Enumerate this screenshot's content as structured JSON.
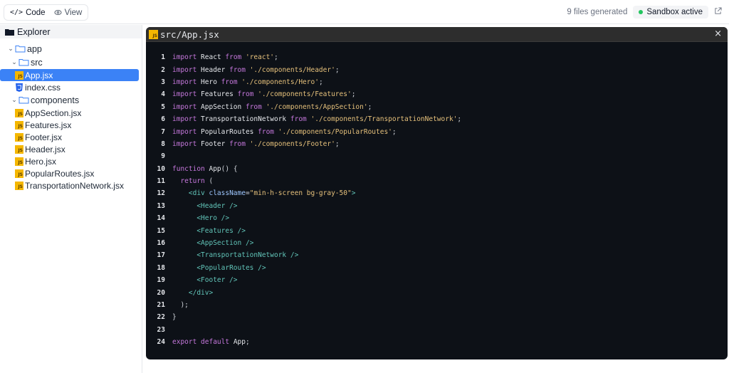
{
  "toolbar": {
    "code_label": "Code",
    "code_icon": "</>",
    "view_label": "View",
    "files_generated": "9 files generated",
    "sandbox_status": "Sandbox active",
    "status_color": "#22c55e"
  },
  "explorer": {
    "title": "Explorer",
    "root": "app",
    "src": "src",
    "app_file": "App.jsx",
    "css_file": "index.css",
    "components_folder": "components",
    "components": [
      "AppSection.jsx",
      "Features.jsx",
      "Footer.jsx",
      "Header.jsx",
      "Hero.jsx",
      "PopularRoutes.jsx",
      "TransportationNetwork.jsx"
    ]
  },
  "editor": {
    "file_path": "src/App.jsx",
    "close_label": "×",
    "lines": [
      [
        [
          "kw",
          "import"
        ],
        [
          "id",
          " React "
        ],
        [
          "kw",
          "from"
        ],
        [
          "str",
          " 'react'"
        ],
        [
          "pun",
          ";"
        ]
      ],
      [
        [
          "kw",
          "import"
        ],
        [
          "id",
          " Header "
        ],
        [
          "kw",
          "from"
        ],
        [
          "str",
          " './components/Header'"
        ],
        [
          "pun",
          ";"
        ]
      ],
      [
        [
          "kw",
          "import"
        ],
        [
          "id",
          " Hero "
        ],
        [
          "kw",
          "from"
        ],
        [
          "str",
          " './components/Hero'"
        ],
        [
          "pun",
          ";"
        ]
      ],
      [
        [
          "kw",
          "import"
        ],
        [
          "id",
          " Features "
        ],
        [
          "kw",
          "from"
        ],
        [
          "str",
          " './components/Features'"
        ],
        [
          "pun",
          ";"
        ]
      ],
      [
        [
          "kw",
          "import"
        ],
        [
          "id",
          " AppSection "
        ],
        [
          "kw",
          "from"
        ],
        [
          "str",
          " './components/AppSection'"
        ],
        [
          "pun",
          ";"
        ]
      ],
      [
        [
          "kw",
          "import"
        ],
        [
          "id",
          " TransportationNetwork "
        ],
        [
          "kw",
          "from"
        ],
        [
          "str",
          " './components/TransportationNetwork'"
        ],
        [
          "pun",
          ";"
        ]
      ],
      [
        [
          "kw",
          "import"
        ],
        [
          "id",
          " PopularRoutes "
        ],
        [
          "kw",
          "from"
        ],
        [
          "str",
          " './components/PopularRoutes'"
        ],
        [
          "pun",
          ";"
        ]
      ],
      [
        [
          "kw",
          "import"
        ],
        [
          "id",
          " Footer "
        ],
        [
          "kw",
          "from"
        ],
        [
          "str",
          " './components/Footer'"
        ],
        [
          "pun",
          ";"
        ]
      ],
      [],
      [
        [
          "kw",
          "function"
        ],
        [
          "fn",
          " App"
        ],
        [
          "pun",
          "() {"
        ]
      ],
      [
        [
          "kw",
          "  return"
        ],
        [
          "pun",
          " ("
        ]
      ],
      [
        [
          "tag",
          "    <div"
        ],
        [
          "attr",
          " className"
        ],
        [
          "pun",
          "="
        ],
        [
          "str",
          "\"min-h-screen bg-gray-50\""
        ],
        [
          "tag",
          ">"
        ]
      ],
      [
        [
          "tag",
          "      <Header />"
        ]
      ],
      [
        [
          "tag",
          "      <Hero />"
        ]
      ],
      [
        [
          "tag",
          "      <Features />"
        ]
      ],
      [
        [
          "tag",
          "      <AppSection />"
        ]
      ],
      [
        [
          "tag",
          "      <TransportationNetwork />"
        ]
      ],
      [
        [
          "tag",
          "      <PopularRoutes />"
        ]
      ],
      [
        [
          "tag",
          "      <Footer />"
        ]
      ],
      [
        [
          "tag",
          "    </div>"
        ]
      ],
      [
        [
          "pun",
          "  );"
        ]
      ],
      [
        [
          "pun",
          "}"
        ]
      ],
      [],
      [
        [
          "kw",
          "export"
        ],
        [
          "kw",
          " default"
        ],
        [
          "id",
          " App"
        ],
        [
          "pun",
          ";"
        ]
      ]
    ]
  }
}
